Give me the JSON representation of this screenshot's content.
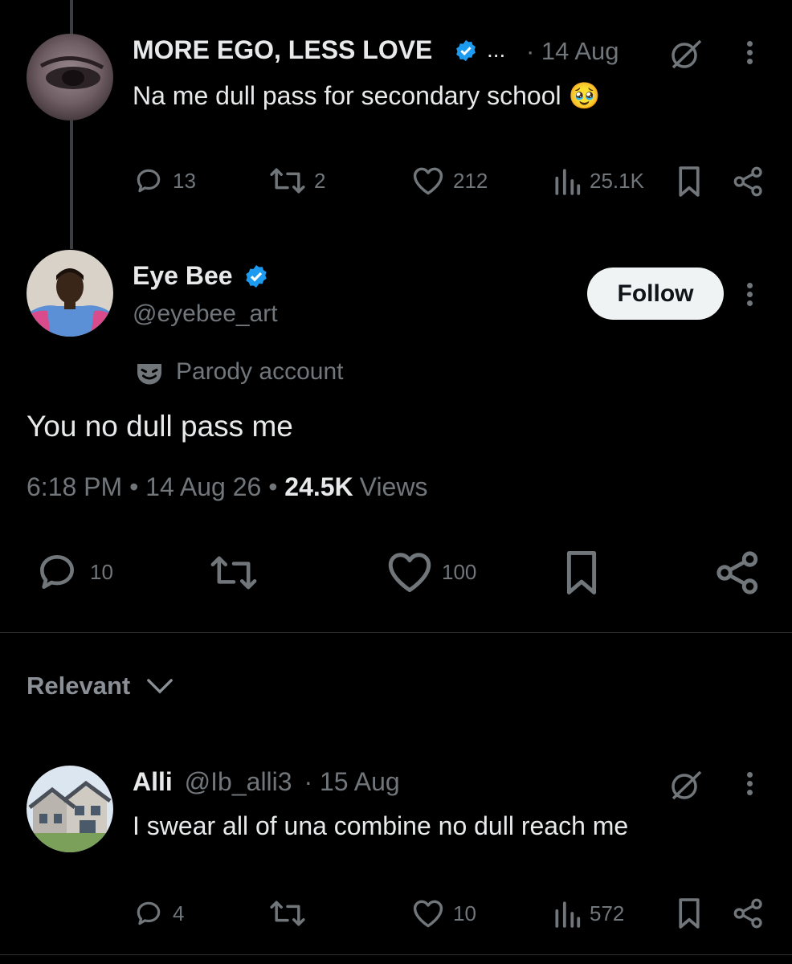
{
  "tweet1": {
    "name": "MORE EGO, LESS LOVE",
    "ellipsis": "...",
    "date": "· 14 Aug",
    "text": "Na me dull pass for secondary school 🥹",
    "replies": "13",
    "reposts": "2",
    "likes": "212",
    "views": "25.1K"
  },
  "main": {
    "name": "Eye Bee",
    "handle": "@eyebee_art",
    "follow_label": "Follow",
    "parody_label": "Parody account",
    "text": "You no dull pass me",
    "time": "6:18 PM",
    "date": "14 Aug 26",
    "views_count": "24.5K",
    "views_label": "Views",
    "replies": "10",
    "likes": "100"
  },
  "sort": {
    "label": "Relevant"
  },
  "reply1": {
    "name": "Alli",
    "handle": "@Ib_alli3",
    "date": "· 15 Aug",
    "text": "I swear all of una combine no dull reach me",
    "replies": "4",
    "likes": "10",
    "views": "572"
  },
  "colors": {
    "verified": "#1d9bf0",
    "muted": "#71767b",
    "background": "#000000"
  }
}
